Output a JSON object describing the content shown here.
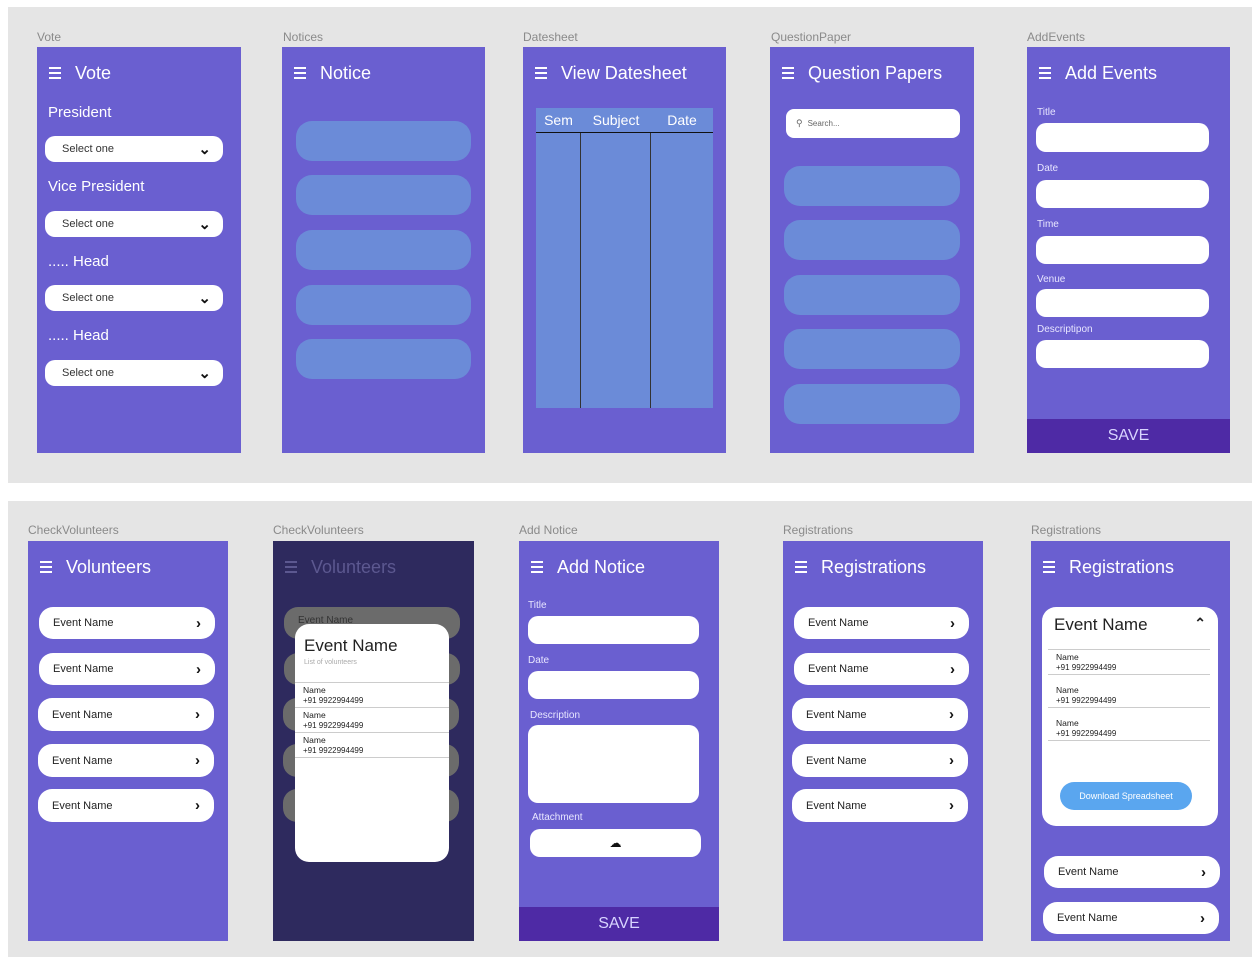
{
  "frames": {
    "vote": {
      "label": "Vote",
      "title": "Vote",
      "sections": [
        {
          "heading": "President",
          "select": "Select one"
        },
        {
          "heading": "Vice President",
          "select": "Select one"
        },
        {
          "heading": "..... Head",
          "select": "Select one"
        },
        {
          "heading": "..... Head",
          "select": "Select one"
        }
      ]
    },
    "notices": {
      "label": "Notices",
      "title": "Notice"
    },
    "datesheet": {
      "label": "Datesheet",
      "title": "View Datesheet",
      "columns": [
        "Sem",
        "Subject",
        "Date"
      ]
    },
    "question_paper": {
      "label": "QuestionPaper",
      "title": "Question Papers",
      "search_placeholder": "Search..."
    },
    "add_events": {
      "label": "AddEvents",
      "title": "Add Events",
      "fields": [
        "Title",
        "Date",
        "Time",
        "Venue",
        "Descriptipon"
      ],
      "save": "SAVE"
    },
    "check_volunteers": {
      "label": "CheckVolunteers",
      "title": "Volunteers",
      "events": [
        "Event Name",
        "Event Name",
        "Event Name",
        "Event Name",
        "Event Name"
      ]
    },
    "check_volunteers_modal": {
      "label": "CheckVolunteers",
      "title": "Volunteers",
      "behind_item": "Event Name",
      "modal_title": "Event Name",
      "modal_subtitle": "List of volunteers",
      "entries": [
        {
          "name": "Name",
          "phone": "+91 9922994499"
        },
        {
          "name": "Name",
          "phone": "+91 9922994499"
        },
        {
          "name": "Name",
          "phone": "+91 9922994499"
        }
      ]
    },
    "add_notice": {
      "label": "Add Notice",
      "title": "Add Notice",
      "fields": [
        "Title",
        "Date",
        "Description"
      ],
      "attachment": "Attachment",
      "save": "SAVE"
    },
    "registrations": {
      "label": "Registrations",
      "title": "Registrations",
      "events": [
        "Event Name",
        "Event Name",
        "Event Name",
        "Event Name",
        "Event Name"
      ]
    },
    "registrations_expanded": {
      "label": "Registrations",
      "title": "Registrations",
      "card_title": "Event Name",
      "entries": [
        {
          "name": "Name",
          "phone": "+91 9922994499"
        },
        {
          "name": "Name",
          "phone": "+91 9922994499"
        },
        {
          "name": "Name",
          "phone": "+91 9922994499"
        }
      ],
      "download": "Download Spreadsheet",
      "events": [
        "Event Name",
        "Event Name"
      ]
    }
  }
}
